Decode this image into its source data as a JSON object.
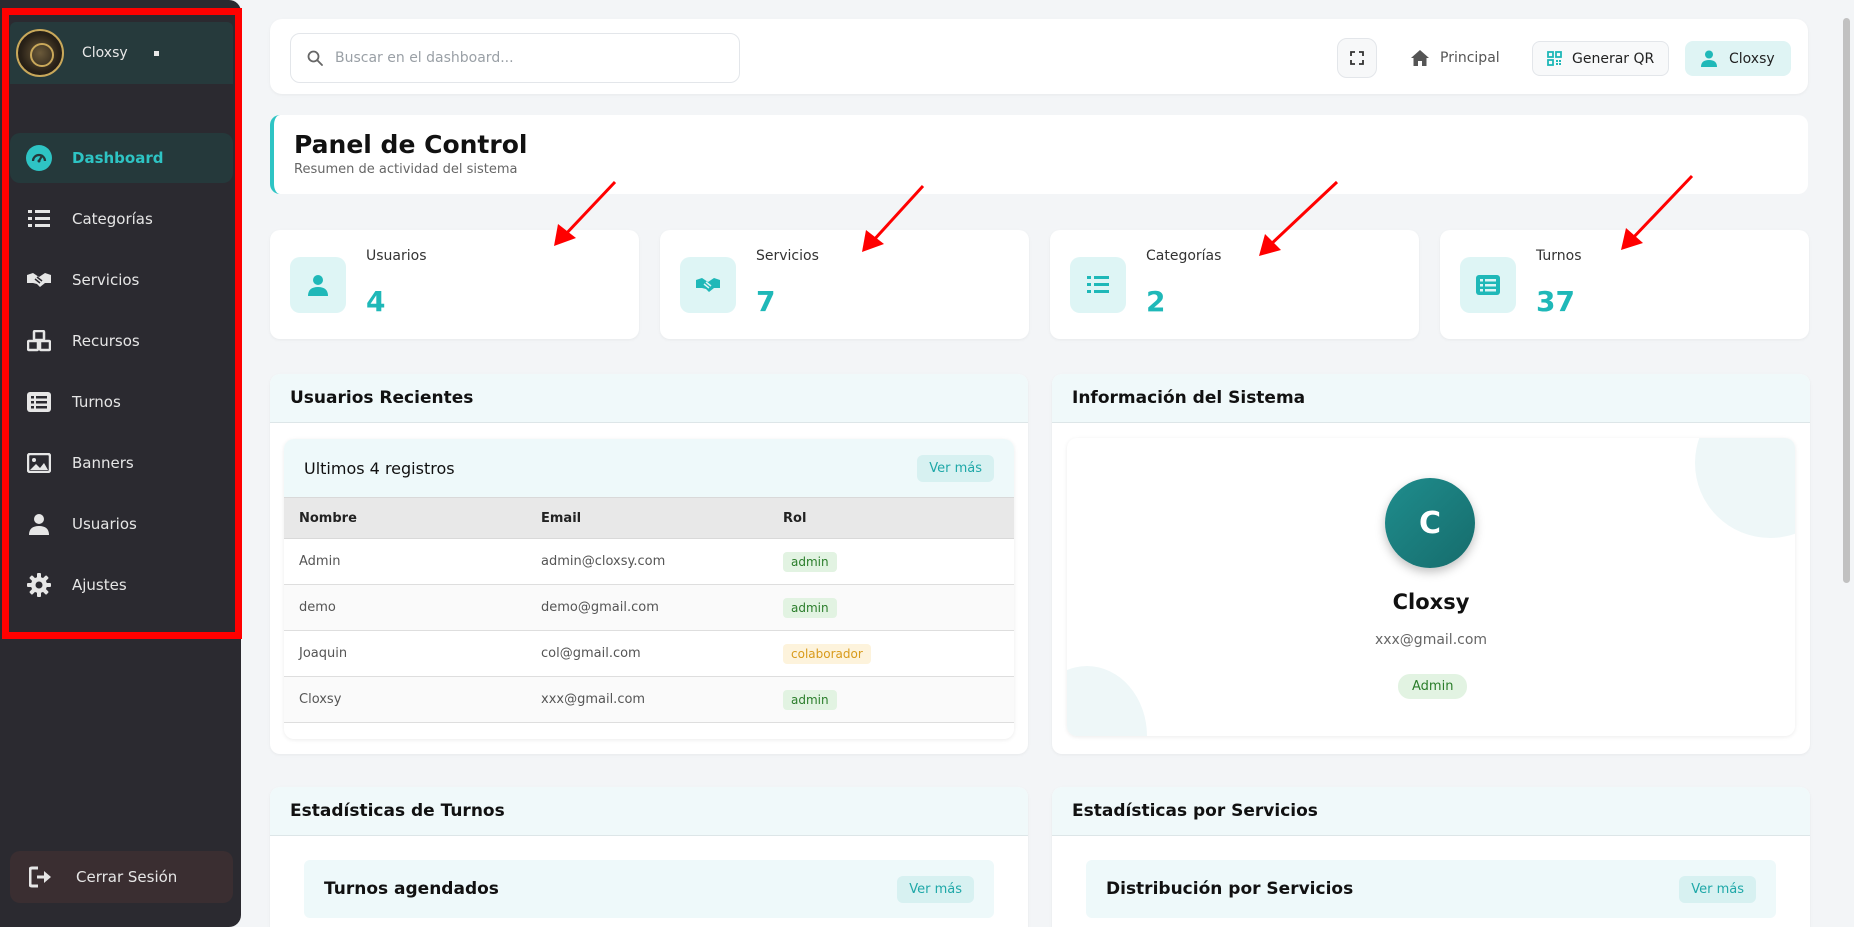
{
  "sidebar": {
    "brand_name": "Cloxsy",
    "items": [
      {
        "label": "Dashboard",
        "icon": "dashboard-gauge-icon"
      },
      {
        "label": "Categorías",
        "icon": "list-icon"
      },
      {
        "label": "Servicios",
        "icon": "handshake-icon"
      },
      {
        "label": "Recursos",
        "icon": "cubes-icon"
      },
      {
        "label": "Turnos",
        "icon": "list-alt-icon"
      },
      {
        "label": "Banners",
        "icon": "image-icon"
      },
      {
        "label": "Usuarios",
        "icon": "user-icon"
      },
      {
        "label": "Ajustes",
        "icon": "gear-icon"
      }
    ],
    "logout_label": "Cerrar Sesión"
  },
  "header": {
    "search_placeholder": "Buscar en el dashboard...",
    "home_label": "Principal",
    "qr_label": "Generar QR",
    "user_label": "Cloxsy"
  },
  "page": {
    "title": "Panel de Control",
    "subtitle": "Resumen de actividad del sistema"
  },
  "stats": [
    {
      "label": "Usuarios",
      "value": "4",
      "icon": "user-icon"
    },
    {
      "label": "Servicios",
      "value": "7",
      "icon": "handshake-icon"
    },
    {
      "label": "Categorías",
      "value": "2",
      "icon": "list-icon"
    },
    {
      "label": "Turnos",
      "value": "37",
      "icon": "list-alt-icon"
    }
  ],
  "recent_users": {
    "title": "Usuarios Recientes",
    "subtitle": "Ultimos 4 registros",
    "more_label": "Ver más",
    "columns": [
      "Nombre",
      "Email",
      "Rol"
    ],
    "rows": [
      {
        "name": "Admin",
        "email": "admin@cloxsy.com",
        "role": "admin"
      },
      {
        "name": "demo",
        "email": "demo@gmail.com",
        "role": "admin"
      },
      {
        "name": "Joaquin",
        "email": "col@gmail.com",
        "role": "colaborador"
      },
      {
        "name": "Cloxsy",
        "email": "xxx@gmail.com",
        "role": "admin"
      }
    ]
  },
  "system_info": {
    "title": "Información del Sistema",
    "avatar_letter": "C",
    "name": "Cloxsy",
    "email": "xxx@gmail.com",
    "role": "Admin"
  },
  "turnos_stats": {
    "title": "Estadísticas de Turnos",
    "card_title": "Turnos agendados",
    "more_label": "Ver más"
  },
  "services_stats": {
    "title": "Estadísticas por Servicios",
    "card_title": "Distribución por Servicios",
    "more_label": "Ver más"
  },
  "colors": {
    "accent": "#2ec4c4",
    "sidebar_bg": "#2b2a30",
    "annotation_red": "#ff0000"
  }
}
